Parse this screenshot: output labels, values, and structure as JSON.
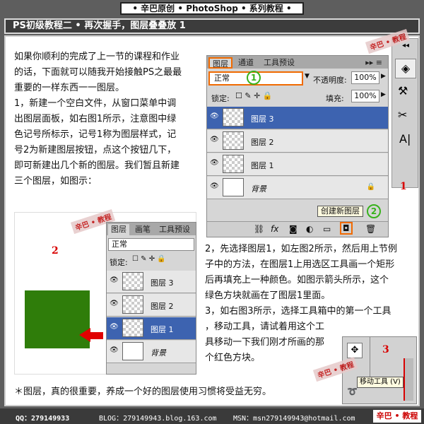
{
  "header": {
    "banner": "• 辛巴原创 • PhotoShop • 系列教程 •",
    "title": "PS初级教程二 • 再次握手，图层叠叠放 1"
  },
  "intro": [
    "如果你顺利的完成了上一节的课程和作业",
    "的话，下面就可以随我开始接触PS之最最",
    "重要的一样东西一一图层。",
    "1，新建一个空白文件，从窗口菜单中调",
    "出图层面板，如右图1所示，注意图中绿",
    "色记号所标示，记号1称为图层样式，记",
    "号2为新建图层按钮，点这个按钮几下，",
    "即可新建出几个新的图层。我们暂且新建",
    "三个图层，如图示："
  ],
  "step2": [
    "2，先选择图层1，如左图2所示，然后用上节例",
    "子中的方法，在图层1上用选区工具画一个矩形",
    "后再填充上一种颜色。如图示箭头所示，这个",
    "绿色方块就画在了图层1里面。"
  ],
  "step3": [
    "3，如右图3所示，选择工具箱中的第一个工具",
    "，移动工具，请试着用这个工",
    "具移动一下我们刚才所画的那",
    "个红色方块。"
  ],
  "note": "＊图层，真的很重要，养成一个好的图层使用习惯将受益无穷。",
  "footer": {
    "qq": "QQ：279149933",
    "blog": "BLOG：279149943.blog.163.com",
    "msn": "MSN：msn279149943@hotmail.com",
    "badge": "辛巴 • 教程"
  },
  "figure_labels": {
    "fig1": "1",
    "fig2": "2",
    "fig3": "3"
  },
  "watermark": "辛巴 • 教程",
  "panel1": {
    "tabs": [
      "图层",
      "通道",
      "工具预设"
    ],
    "blend_mode": "正常",
    "opacity_label": "不透明度:",
    "opacity_value": "100%",
    "lock_label": "锁定:",
    "fill_label": "填充:",
    "fill_value": "100%",
    "layers": [
      "图层 3",
      "图层 2",
      "图层 1",
      "背景"
    ],
    "tooltip": "创建新图层",
    "mark1": "1",
    "mark2": "2"
  },
  "panel2": {
    "tabs": [
      "图层",
      "画笔",
      "工具预设"
    ],
    "blend_mode": "正常",
    "lock_label": "锁定:",
    "layers": [
      "图层 3",
      "图层 2",
      "图层 1",
      "背景"
    ]
  },
  "panel3": {
    "tooltip": "移动工具 (V)"
  },
  "colors": {
    "green_square": "#2f7d0a",
    "selected_layer": "#3d63b0",
    "arrow_red": "#e00000",
    "highlight_orange": "#f06a00",
    "marker_green": "#38b21c"
  }
}
